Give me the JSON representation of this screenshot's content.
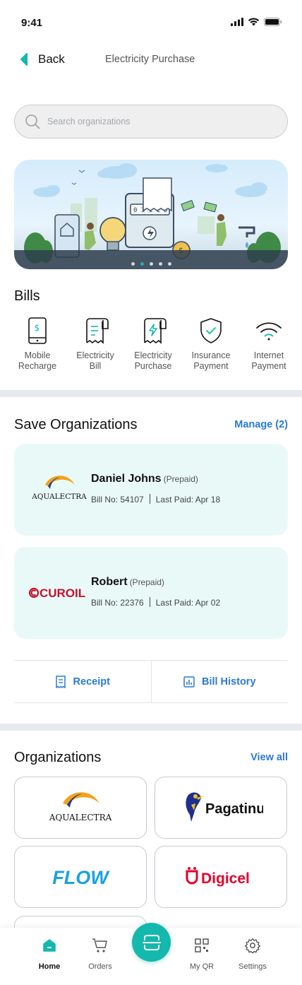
{
  "status_bar": {
    "time": "9:41"
  },
  "nav": {
    "back_label": "Back",
    "title": "Electricity Purchase"
  },
  "search": {
    "placeholder": "Search organizations"
  },
  "banner": {
    "dots": 5,
    "active_dot": 1
  },
  "bills": {
    "title": "Bills",
    "items": [
      {
        "line1": "Mobile",
        "line2": "Recharge",
        "icon": "mobile-recharge-icon"
      },
      {
        "line1": "Electricity",
        "line2": "Bill",
        "icon": "electricity-bill-icon"
      },
      {
        "line1": "Electricity",
        "line2": "Purchase",
        "icon": "electricity-purchase-icon"
      },
      {
        "line1": "Insurance",
        "line2": "Payment",
        "icon": "insurance-shield-icon"
      },
      {
        "line1": "Internet",
        "line2": "Payment",
        "icon": "wifi-icon"
      }
    ]
  },
  "saved": {
    "title": "Save Organizations",
    "manage_label": "Manage (2)",
    "cards": [
      {
        "name": "Daniel Johns",
        "type": "(Prepaid)",
        "bill_no": "Bill No: 54107",
        "last_paid": "Last Paid: Apr 18",
        "logo_text": "AQUALECTRA"
      },
      {
        "name": "Robert",
        "type": "(Prepaid)",
        "bill_no": "Bill No: 22376",
        "last_paid": "Last Paid: Apr 02",
        "logo_text": "CUROIL"
      }
    ],
    "actions": {
      "receipt": "Receipt",
      "bill_history": "Bill History"
    }
  },
  "organizations": {
    "title": "Organizations",
    "view_all": "View all",
    "tiles": [
      "AQUALECTRA",
      "Pagatinu",
      "FLOW",
      "Digicel"
    ]
  },
  "tabbar": {
    "items": [
      {
        "label": "Home",
        "active": true
      },
      {
        "label": "Orders",
        "active": false
      },
      {
        "label": "My QR",
        "active": false
      },
      {
        "label": "Settings",
        "active": false
      }
    ]
  },
  "colors": {
    "accent": "#14b8ad",
    "link": "#2a7ad6",
    "card_bg": "#e9f9f8"
  }
}
